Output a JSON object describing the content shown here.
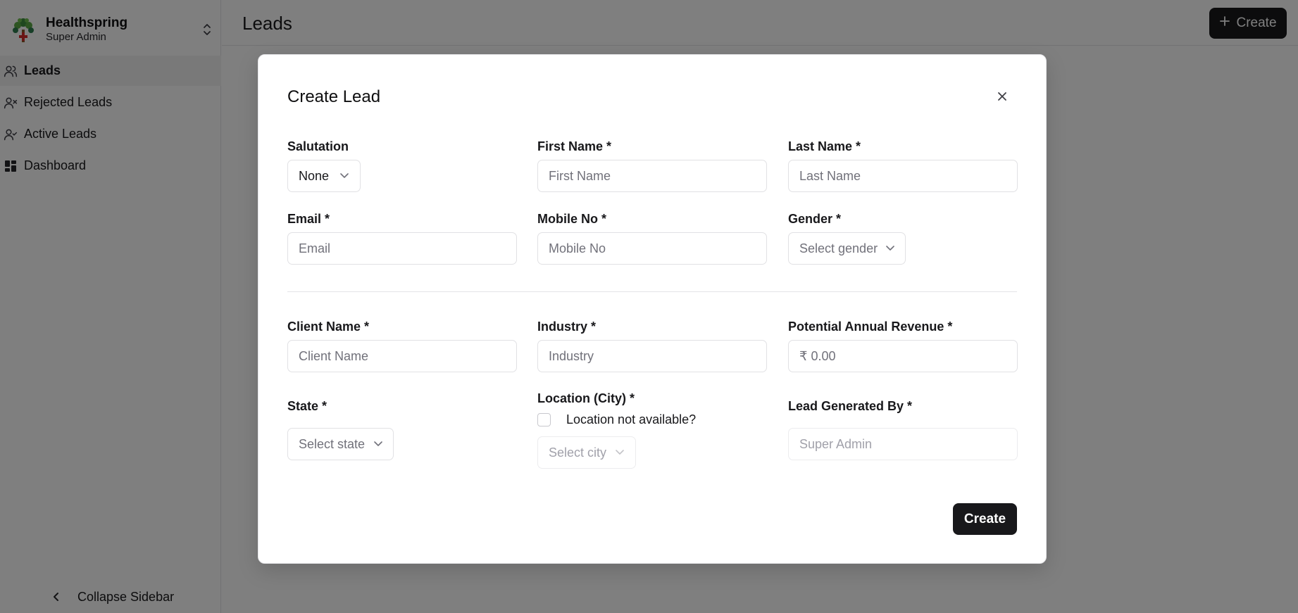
{
  "sidebar": {
    "brand": {
      "name": "Healthspring",
      "role": "Super Admin"
    },
    "items": [
      {
        "label": "Leads",
        "icon": "users-icon",
        "active": true
      },
      {
        "label": "Rejected Leads",
        "icon": "user-x-icon",
        "active": false
      },
      {
        "label": "Active Leads",
        "icon": "user-check-icon",
        "active": false
      },
      {
        "label": "Dashboard",
        "icon": "dashboard-grid-icon",
        "active": false
      }
    ],
    "collapse_label": "Collapse Sidebar"
  },
  "header": {
    "title": "Leads",
    "create_label": "Create"
  },
  "modal": {
    "title": "Create Lead",
    "fields": {
      "salutation": {
        "label": "Salutation",
        "value": "None"
      },
      "first_name": {
        "label": "First Name *",
        "placeholder": "First Name"
      },
      "last_name": {
        "label": "Last Name *",
        "placeholder": "Last Name"
      },
      "email": {
        "label": "Email *",
        "placeholder": "Email"
      },
      "mobile": {
        "label": "Mobile No *",
        "placeholder": "Mobile No"
      },
      "gender": {
        "label": "Gender *",
        "placeholder": "Select gender"
      },
      "client_name": {
        "label": "Client Name *",
        "placeholder": "Client Name"
      },
      "industry": {
        "label": "Industry *",
        "placeholder": "Industry"
      },
      "revenue": {
        "label": "Potential Annual Revenue *",
        "placeholder": "₹ 0.00"
      },
      "state": {
        "label": "State *",
        "placeholder": "Select state"
      },
      "city": {
        "label": "Location (City) *",
        "checkbox_label": "Location not available?",
        "placeholder": "Select city"
      },
      "generated_by": {
        "label": "Lead Generated By *",
        "value": "Super Admin"
      }
    },
    "submit_label": "Create"
  },
  "colors": {
    "primary": "#18181b",
    "overlay": "rgba(0,0,0,0.5)",
    "border": "#e4e4e7",
    "placeholder": "#71717a"
  }
}
